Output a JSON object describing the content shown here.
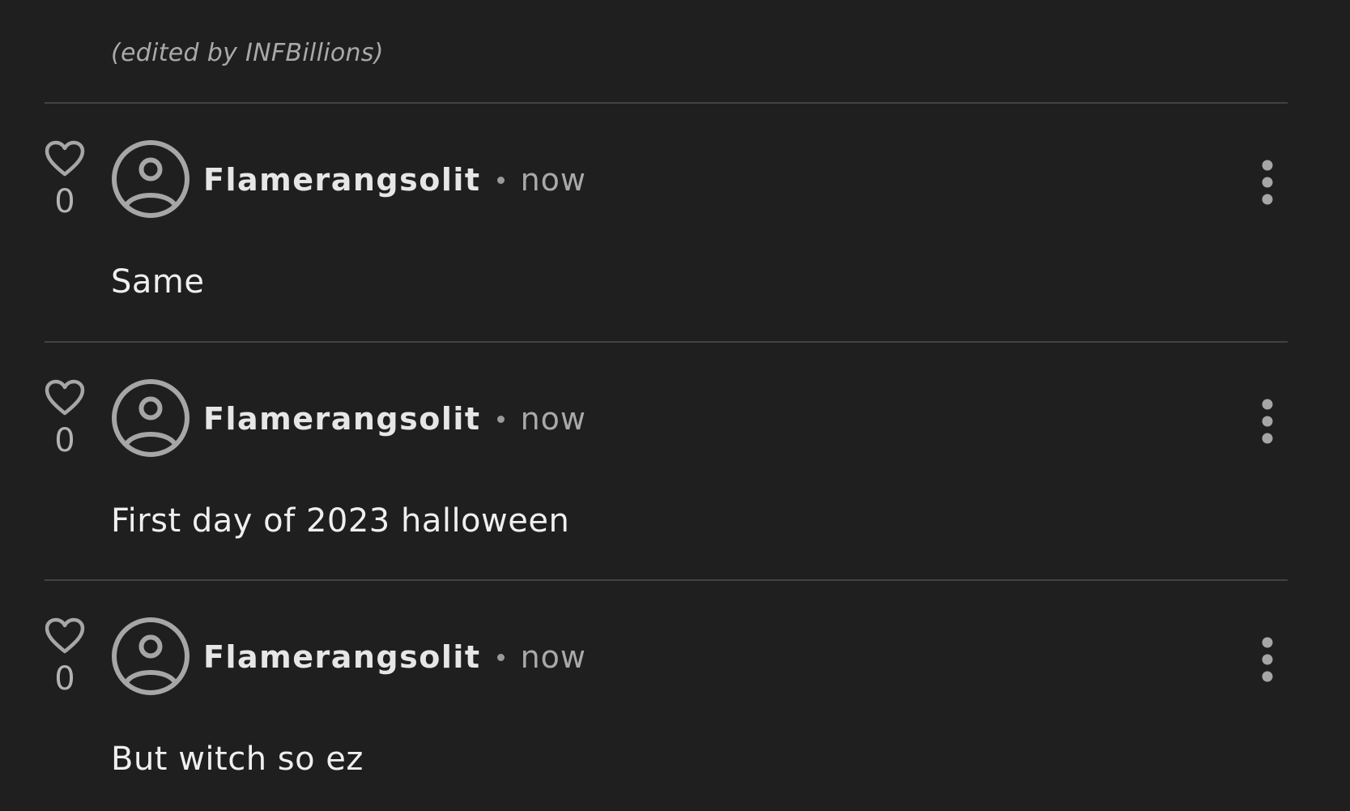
{
  "edited_note": "(edited by INFBillions)",
  "comments": [
    {
      "likes": "0",
      "username": "Flamerangsolit",
      "time": "now",
      "text": "Same"
    },
    {
      "likes": "0",
      "username": "Flamerangsolit",
      "time": "now",
      "text": "First day of 2023 halloween"
    },
    {
      "likes": "0",
      "username": "Flamerangsolit",
      "time": "now",
      "text": "But witch so ez"
    }
  ],
  "icons": {
    "like": "heart-icon",
    "avatar": "user-avatar-icon",
    "more": "more-vertical-icon"
  },
  "colors": {
    "background": "#1f1f1f",
    "divider": "#424242",
    "icon": "#a6a6a6",
    "username": "#e6e6e6",
    "muted": "#a9a9a9",
    "body": "#efefef"
  }
}
